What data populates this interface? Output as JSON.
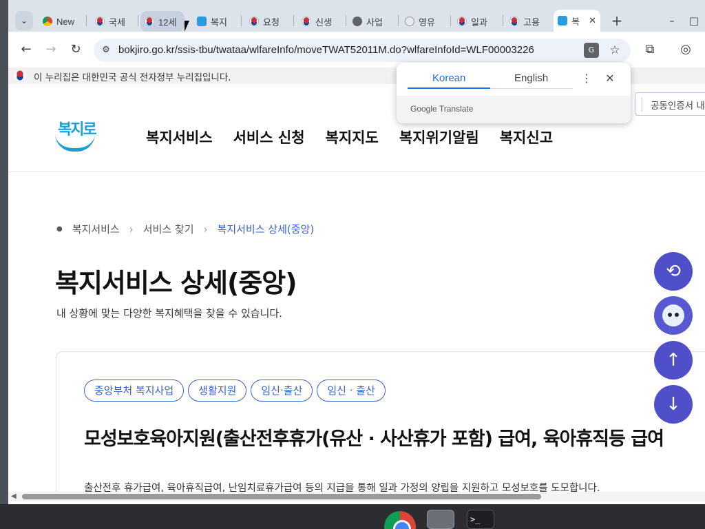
{
  "browser": {
    "tabs": [
      {
        "label": "New",
        "favicon": "chrome-icon"
      },
      {
        "label": "국세",
        "favicon": "korea-flag-icon"
      },
      {
        "label": "12세",
        "favicon": "korea-flag-icon"
      },
      {
        "label": "복지",
        "favicon": "bokjiro-icon"
      },
      {
        "label": "요청",
        "favicon": "korea-flag-icon"
      },
      {
        "label": "신생",
        "favicon": "korea-flag-icon"
      },
      {
        "label": "사업",
        "favicon": "globe-icon"
      },
      {
        "label": "영유",
        "favicon": "character-icon"
      },
      {
        "label": "일과",
        "favicon": "korea-flag-icon"
      },
      {
        "label": "고용",
        "favicon": "korea-flag-icon"
      },
      {
        "label": "복",
        "favicon": "bokjiro-icon"
      }
    ],
    "new_tab_symbol": "+",
    "window_controls": {
      "minimize": "–",
      "maximize": "□",
      "close": "✕"
    },
    "url": "bokjiro.go.kr/ssis-tbu/twataa/wlfareInfo/moveTWAT52011M.do?wlfareInfoId=WLF00003226",
    "nav": {
      "back": "←",
      "forward": "→",
      "reload": "↻"
    }
  },
  "gov_banner": "이 누리집은 대한민국 공식 전자정부 누리집입니다.",
  "translate_popup": {
    "source_lang": "Korean",
    "target_lang": "English",
    "brand": "Google Translate",
    "more": "⋮",
    "close": "✕"
  },
  "site": {
    "logo_text": "복지로",
    "nav": [
      "복지서비스",
      "서비스 신청",
      "복지지도",
      "복지위기알림",
      "복지신고"
    ],
    "cert_link": "공동인증서 내"
  },
  "breadcrumb": {
    "items": [
      "복지서비스",
      "서비스 찾기",
      "복지서비스 상세(중앙)"
    ]
  },
  "page": {
    "title": "복지서비스 상세(중앙)",
    "subtitle": "내 상황에 맞는 다양한 복지혜택을 찾을 수 있습니다."
  },
  "service": {
    "tags": [
      "중앙부처 복지사업",
      "생활지원",
      "임신·출산",
      "임신 · 출산"
    ],
    "title": "모성보호육아지원(출산전후휴가(유산 · 사산휴가 포함) 급여, 육아휴직등 급여",
    "description": "출산전후 휴가급여, 육아휴직급여, 난임치료휴가급여 등의 지급을 통해 일과 가정의 양립을 지원하고 모성보호를 도모합니다."
  },
  "floating_buttons": [
    {
      "name": "history-icon",
      "glyph": "⟲"
    },
    {
      "name": "chatbot-icon",
      "glyph": ""
    },
    {
      "name": "scroll-up-icon",
      "glyph": "↑"
    },
    {
      "name": "scroll-down-icon",
      "glyph": "↓"
    }
  ],
  "colors": {
    "accent": "#3a62c9",
    "float": "#4f4fc9",
    "logo": "#1a9fd9"
  }
}
